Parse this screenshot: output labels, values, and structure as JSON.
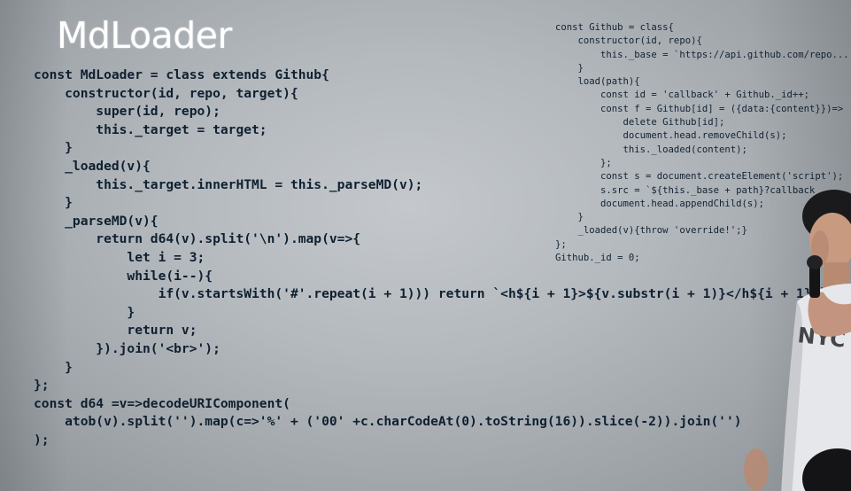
{
  "slide": {
    "title": "MdLoader",
    "main_code": [
      "const MdLoader = class extends Github{",
      "    constructor(id, repo, target){",
      "        super(id, repo);",
      "        this._target = target;",
      "    }",
      "    _loaded(v){",
      "        this._target.innerHTML = this._parseMD(v);",
      "    }",
      "    _parseMD(v){",
      "        return d64(v).split('\\n').map(v=>{",
      "            let i = 3;",
      "            while(i--){",
      "                if(v.startsWith('#'.repeat(i + 1))) return `<h${i + 1}>${v.substr(i + 1)}</h${i + 1}>`",
      "            }",
      "            return v;",
      "        }).join('<br>');",
      "    }",
      "};",
      "const d64 =v=>decodeURIComponent(",
      "    atob(v).split('').map(c=>'%' + ('00' +c.charCodeAt(0).toString(16)).slice(-2)).join('')",
      ");"
    ],
    "side_code": [
      "const Github = class{",
      "    constructor(id, repo){",
      "        this._base = `https://api.github.com/repo...",
      "    }",
      "    load(path){",
      "        const id = 'callback' + Github._id++;",
      "        const f = Github[id] = ({data:{content}})=>",
      "            delete Github[id];",
      "            document.head.removeChild(s);",
      "            this._loaded(content);",
      "        };",
      "        const s = document.createElement('script');",
      "        s.src = `${this._base + path}?callback",
      "        document.head.appendChild(s);",
      "    }",
      "    _loaded(v){throw 'override!';}",
      "};",
      "Github._id = 0;"
    ]
  },
  "colors": {
    "background": "#b4b9be",
    "title": "#ffffff",
    "code_text": "#0f2030"
  },
  "decorations": {
    "presenter": "person-photo"
  }
}
